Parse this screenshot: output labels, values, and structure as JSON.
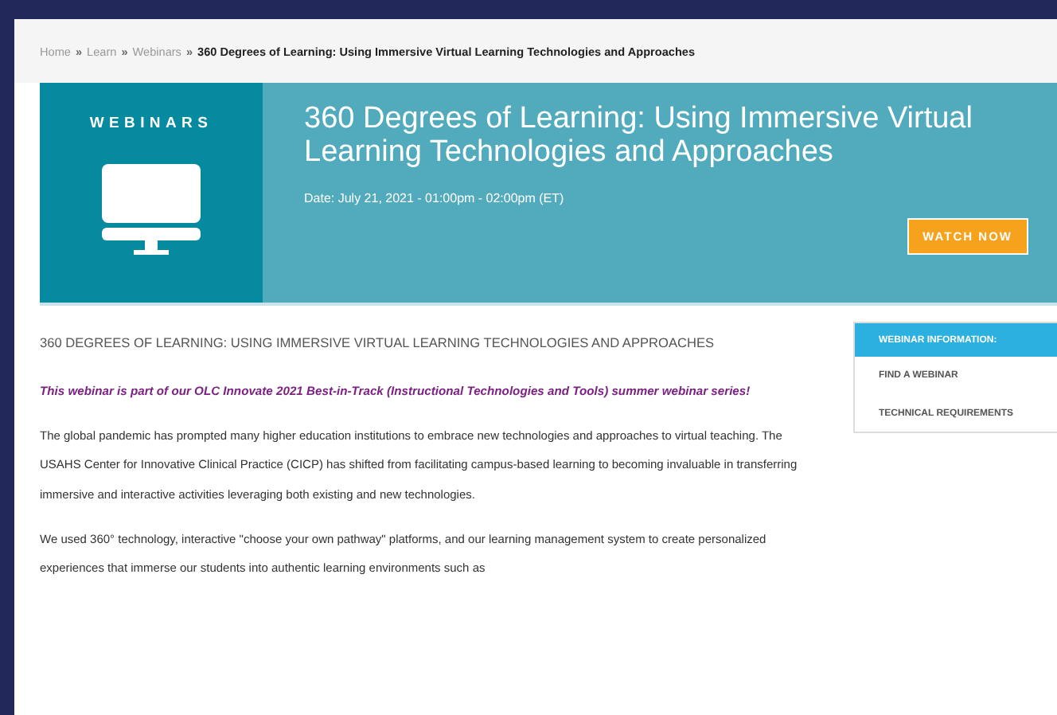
{
  "breadcrumb": [
    {
      "label": "Home",
      "current": false
    },
    {
      "label": "Learn",
      "current": false
    },
    {
      "label": "Webinars",
      "current": false
    },
    {
      "label": "360 Degrees of Learning: Using Immersive Virtual Learning Technologies and Approaches",
      "current": true
    }
  ],
  "breadcrumb_separator": "»",
  "banner": {
    "category": "WEBINARS",
    "title": "360 Degrees of Learning: Using Immersive Virtual Learning Technologies and Approaches",
    "date": "Date: July 21, 2021 - 01:00pm - 02:00pm (ET)",
    "button": "WATCH NOW"
  },
  "article": {
    "heading": "360 DEGREES OF LEARNING: USING IMMERSIVE VIRTUAL LEARNING TECHNOLOGIES AND APPROACHES",
    "intro": "This webinar is part of our OLC Innovate 2021 Best-in-Track (Instructional Technologies and Tools) summer webinar series!",
    "paragraphs": [
      "The global pandemic has prompted many higher education institutions to embrace new technologies and approaches to virtual teaching. The USAHS Center for Innovative Clinical Practice (CICP) has shifted from facilitating campus-based learning to becoming invaluable in transferring immersive and interactive activities leveraging both existing and new technologies.",
      "We used 360° technology, interactive \"choose your own pathway\" platforms, and our learning management system to create personalized experiences that immerse our students into authentic learning environments such as"
    ]
  },
  "sidebar": {
    "items": [
      {
        "label": "WEBINAR INFORMATION:",
        "selected": true
      },
      {
        "label": "FIND A WEBINAR",
        "selected": false
      },
      {
        "label": "TECHNICAL REQUIREMENTS",
        "selected": false
      }
    ]
  }
}
